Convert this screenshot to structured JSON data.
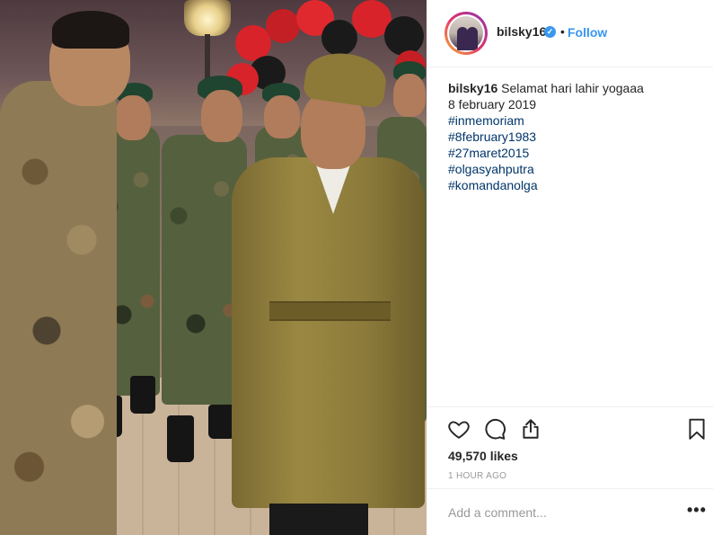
{
  "post": {
    "photo_alt": "Photo",
    "username": "bilsky16",
    "verified": true,
    "dot": "•",
    "follow_label": "Follow",
    "caption": {
      "username": "bilsky16",
      "text": "Selamat hari lahir yogaaa",
      "line2": "8 february 2019",
      "hashtags": [
        "#inmemoriam",
        "#8february1983",
        "#27maret2015",
        "#olgasyahputra",
        "#komandanolga"
      ]
    },
    "likes": "49,570 likes",
    "timestamp": "1 HOUR AGO",
    "comment_placeholder": "Add a comment...",
    "more_label": "•••"
  },
  "icons": {
    "like": "heart-icon",
    "comment": "comment-bubble-icon",
    "share": "share-icon",
    "save": "bookmark-icon",
    "verified": "verified-badge-icon"
  },
  "colors": {
    "link_blue": "#3897f0",
    "hashtag": "#003569",
    "text": "#262626",
    "muted": "#999999",
    "border": "#efefef"
  }
}
